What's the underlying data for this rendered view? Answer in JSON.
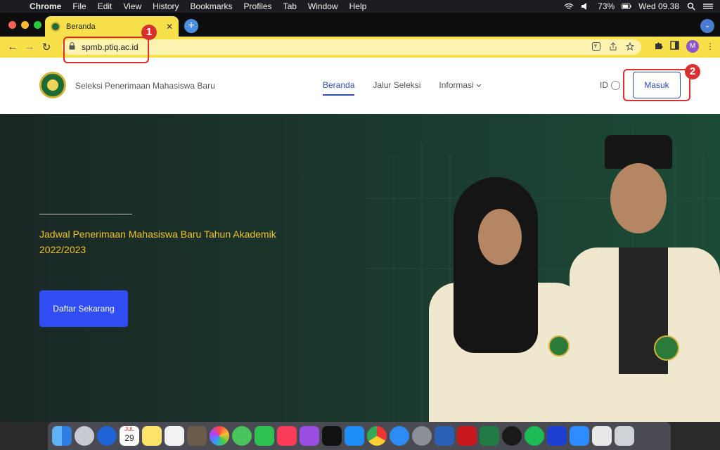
{
  "menubar": {
    "app_name": "Chrome",
    "items": [
      "File",
      "Edit",
      "View",
      "History",
      "Bookmarks",
      "Profiles",
      "Tab",
      "Window",
      "Help"
    ],
    "battery": "73%",
    "clock": "Wed 09.38"
  },
  "browser": {
    "tab_title": "Beranda",
    "url": "spmb.ptiq.ac.id",
    "profile_initial": "M"
  },
  "annotations": [
    "1",
    "2"
  ],
  "site": {
    "name": "Seleksi Penerimaan Mahasiswa Baru",
    "nav": [
      "Beranda",
      "Jalur Seleksi",
      "Informasi"
    ],
    "lang": "ID",
    "login_label": "Masuk"
  },
  "hero": {
    "heading": "Jadwal Penerimaan Mahasiswa Baru Tahun Akademik 2022/2023",
    "cta_label": "Daftar Sekarang"
  },
  "dock": {
    "calendar_day": "29",
    "calendar_month": "JUL"
  },
  "colors": {
    "chrome_theme": "#f7e04a",
    "hero_heading": "#f0c22c",
    "cta": "#2f4df3",
    "annotation": "#d8302f",
    "nav_active": "#2c4fb0"
  },
  "icons": [
    "apple-icon",
    "lock-icon",
    "translate-icon",
    "share-icon",
    "star-icon",
    "puzzle-icon",
    "sidebar-icon",
    "globe-icon",
    "chevron-down-icon"
  ]
}
